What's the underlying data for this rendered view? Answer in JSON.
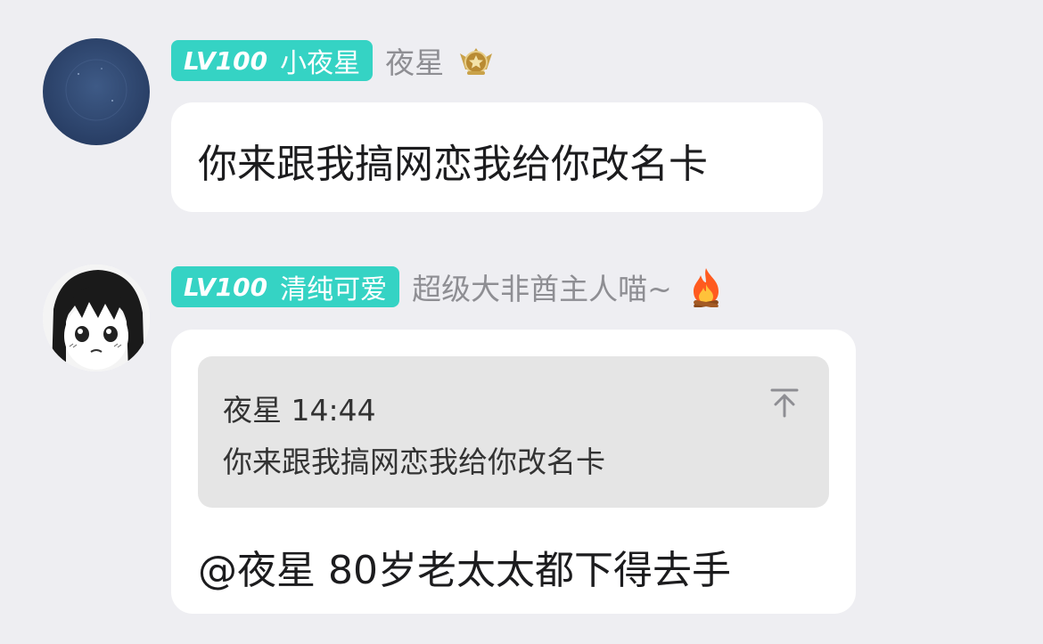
{
  "messages": [
    {
      "level_badge": "LV100",
      "title": "小夜星",
      "nickname": "夜星",
      "badge_icon": "medal-icon",
      "text": "你来跟我搞网恋我给你改名卡"
    },
    {
      "level_badge": "LV100",
      "title": "清纯可爱",
      "nickname": "超级大非酋主人喵~",
      "badge_icon": "fire-icon",
      "quote": {
        "author": "夜星",
        "time": "14:44",
        "text": "你来跟我搞网恋我给你改名卡"
      },
      "text": "@夜星 80岁老太太都下得去手"
    }
  ],
  "colors": {
    "background": "#eeeef2",
    "level_badge": "#35d3c4",
    "bubble": "#ffffff",
    "quote_bg": "#e5e5e5",
    "nickname": "#8e8e93"
  }
}
